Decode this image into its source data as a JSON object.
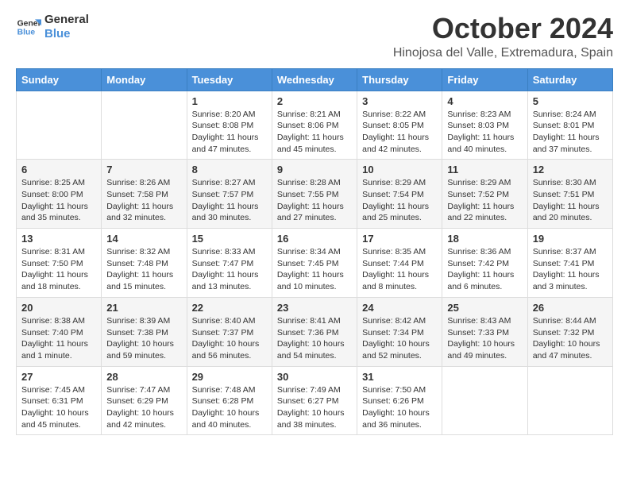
{
  "logo": {
    "text_general": "General",
    "text_blue": "Blue"
  },
  "header": {
    "title": "October 2024",
    "subtitle": "Hinojosa del Valle, Extremadura, Spain"
  },
  "weekdays": [
    "Sunday",
    "Monday",
    "Tuesday",
    "Wednesday",
    "Thursday",
    "Friday",
    "Saturday"
  ],
  "weeks": [
    [
      {
        "day": "",
        "info": ""
      },
      {
        "day": "",
        "info": ""
      },
      {
        "day": "1",
        "info": "Sunrise: 8:20 AM\nSunset: 8:08 PM\nDaylight: 11 hours and 47 minutes."
      },
      {
        "day": "2",
        "info": "Sunrise: 8:21 AM\nSunset: 8:06 PM\nDaylight: 11 hours and 45 minutes."
      },
      {
        "day": "3",
        "info": "Sunrise: 8:22 AM\nSunset: 8:05 PM\nDaylight: 11 hours and 42 minutes."
      },
      {
        "day": "4",
        "info": "Sunrise: 8:23 AM\nSunset: 8:03 PM\nDaylight: 11 hours and 40 minutes."
      },
      {
        "day": "5",
        "info": "Sunrise: 8:24 AM\nSunset: 8:01 PM\nDaylight: 11 hours and 37 minutes."
      }
    ],
    [
      {
        "day": "6",
        "info": "Sunrise: 8:25 AM\nSunset: 8:00 PM\nDaylight: 11 hours and 35 minutes."
      },
      {
        "day": "7",
        "info": "Sunrise: 8:26 AM\nSunset: 7:58 PM\nDaylight: 11 hours and 32 minutes."
      },
      {
        "day": "8",
        "info": "Sunrise: 8:27 AM\nSunset: 7:57 PM\nDaylight: 11 hours and 30 minutes."
      },
      {
        "day": "9",
        "info": "Sunrise: 8:28 AM\nSunset: 7:55 PM\nDaylight: 11 hours and 27 minutes."
      },
      {
        "day": "10",
        "info": "Sunrise: 8:29 AM\nSunset: 7:54 PM\nDaylight: 11 hours and 25 minutes."
      },
      {
        "day": "11",
        "info": "Sunrise: 8:29 AM\nSunset: 7:52 PM\nDaylight: 11 hours and 22 minutes."
      },
      {
        "day": "12",
        "info": "Sunrise: 8:30 AM\nSunset: 7:51 PM\nDaylight: 11 hours and 20 minutes."
      }
    ],
    [
      {
        "day": "13",
        "info": "Sunrise: 8:31 AM\nSunset: 7:50 PM\nDaylight: 11 hours and 18 minutes."
      },
      {
        "day": "14",
        "info": "Sunrise: 8:32 AM\nSunset: 7:48 PM\nDaylight: 11 hours and 15 minutes."
      },
      {
        "day": "15",
        "info": "Sunrise: 8:33 AM\nSunset: 7:47 PM\nDaylight: 11 hours and 13 minutes."
      },
      {
        "day": "16",
        "info": "Sunrise: 8:34 AM\nSunset: 7:45 PM\nDaylight: 11 hours and 10 minutes."
      },
      {
        "day": "17",
        "info": "Sunrise: 8:35 AM\nSunset: 7:44 PM\nDaylight: 11 hours and 8 minutes."
      },
      {
        "day": "18",
        "info": "Sunrise: 8:36 AM\nSunset: 7:42 PM\nDaylight: 11 hours and 6 minutes."
      },
      {
        "day": "19",
        "info": "Sunrise: 8:37 AM\nSunset: 7:41 PM\nDaylight: 11 hours and 3 minutes."
      }
    ],
    [
      {
        "day": "20",
        "info": "Sunrise: 8:38 AM\nSunset: 7:40 PM\nDaylight: 11 hours and 1 minute."
      },
      {
        "day": "21",
        "info": "Sunrise: 8:39 AM\nSunset: 7:38 PM\nDaylight: 10 hours and 59 minutes."
      },
      {
        "day": "22",
        "info": "Sunrise: 8:40 AM\nSunset: 7:37 PM\nDaylight: 10 hours and 56 minutes."
      },
      {
        "day": "23",
        "info": "Sunrise: 8:41 AM\nSunset: 7:36 PM\nDaylight: 10 hours and 54 minutes."
      },
      {
        "day": "24",
        "info": "Sunrise: 8:42 AM\nSunset: 7:34 PM\nDaylight: 10 hours and 52 minutes."
      },
      {
        "day": "25",
        "info": "Sunrise: 8:43 AM\nSunset: 7:33 PM\nDaylight: 10 hours and 49 minutes."
      },
      {
        "day": "26",
        "info": "Sunrise: 8:44 AM\nSunset: 7:32 PM\nDaylight: 10 hours and 47 minutes."
      }
    ],
    [
      {
        "day": "27",
        "info": "Sunrise: 7:45 AM\nSunset: 6:31 PM\nDaylight: 10 hours and 45 minutes."
      },
      {
        "day": "28",
        "info": "Sunrise: 7:47 AM\nSunset: 6:29 PM\nDaylight: 10 hours and 42 minutes."
      },
      {
        "day": "29",
        "info": "Sunrise: 7:48 AM\nSunset: 6:28 PM\nDaylight: 10 hours and 40 minutes."
      },
      {
        "day": "30",
        "info": "Sunrise: 7:49 AM\nSunset: 6:27 PM\nDaylight: 10 hours and 38 minutes."
      },
      {
        "day": "31",
        "info": "Sunrise: 7:50 AM\nSunset: 6:26 PM\nDaylight: 10 hours and 36 minutes."
      },
      {
        "day": "",
        "info": ""
      },
      {
        "day": "",
        "info": ""
      }
    ]
  ]
}
